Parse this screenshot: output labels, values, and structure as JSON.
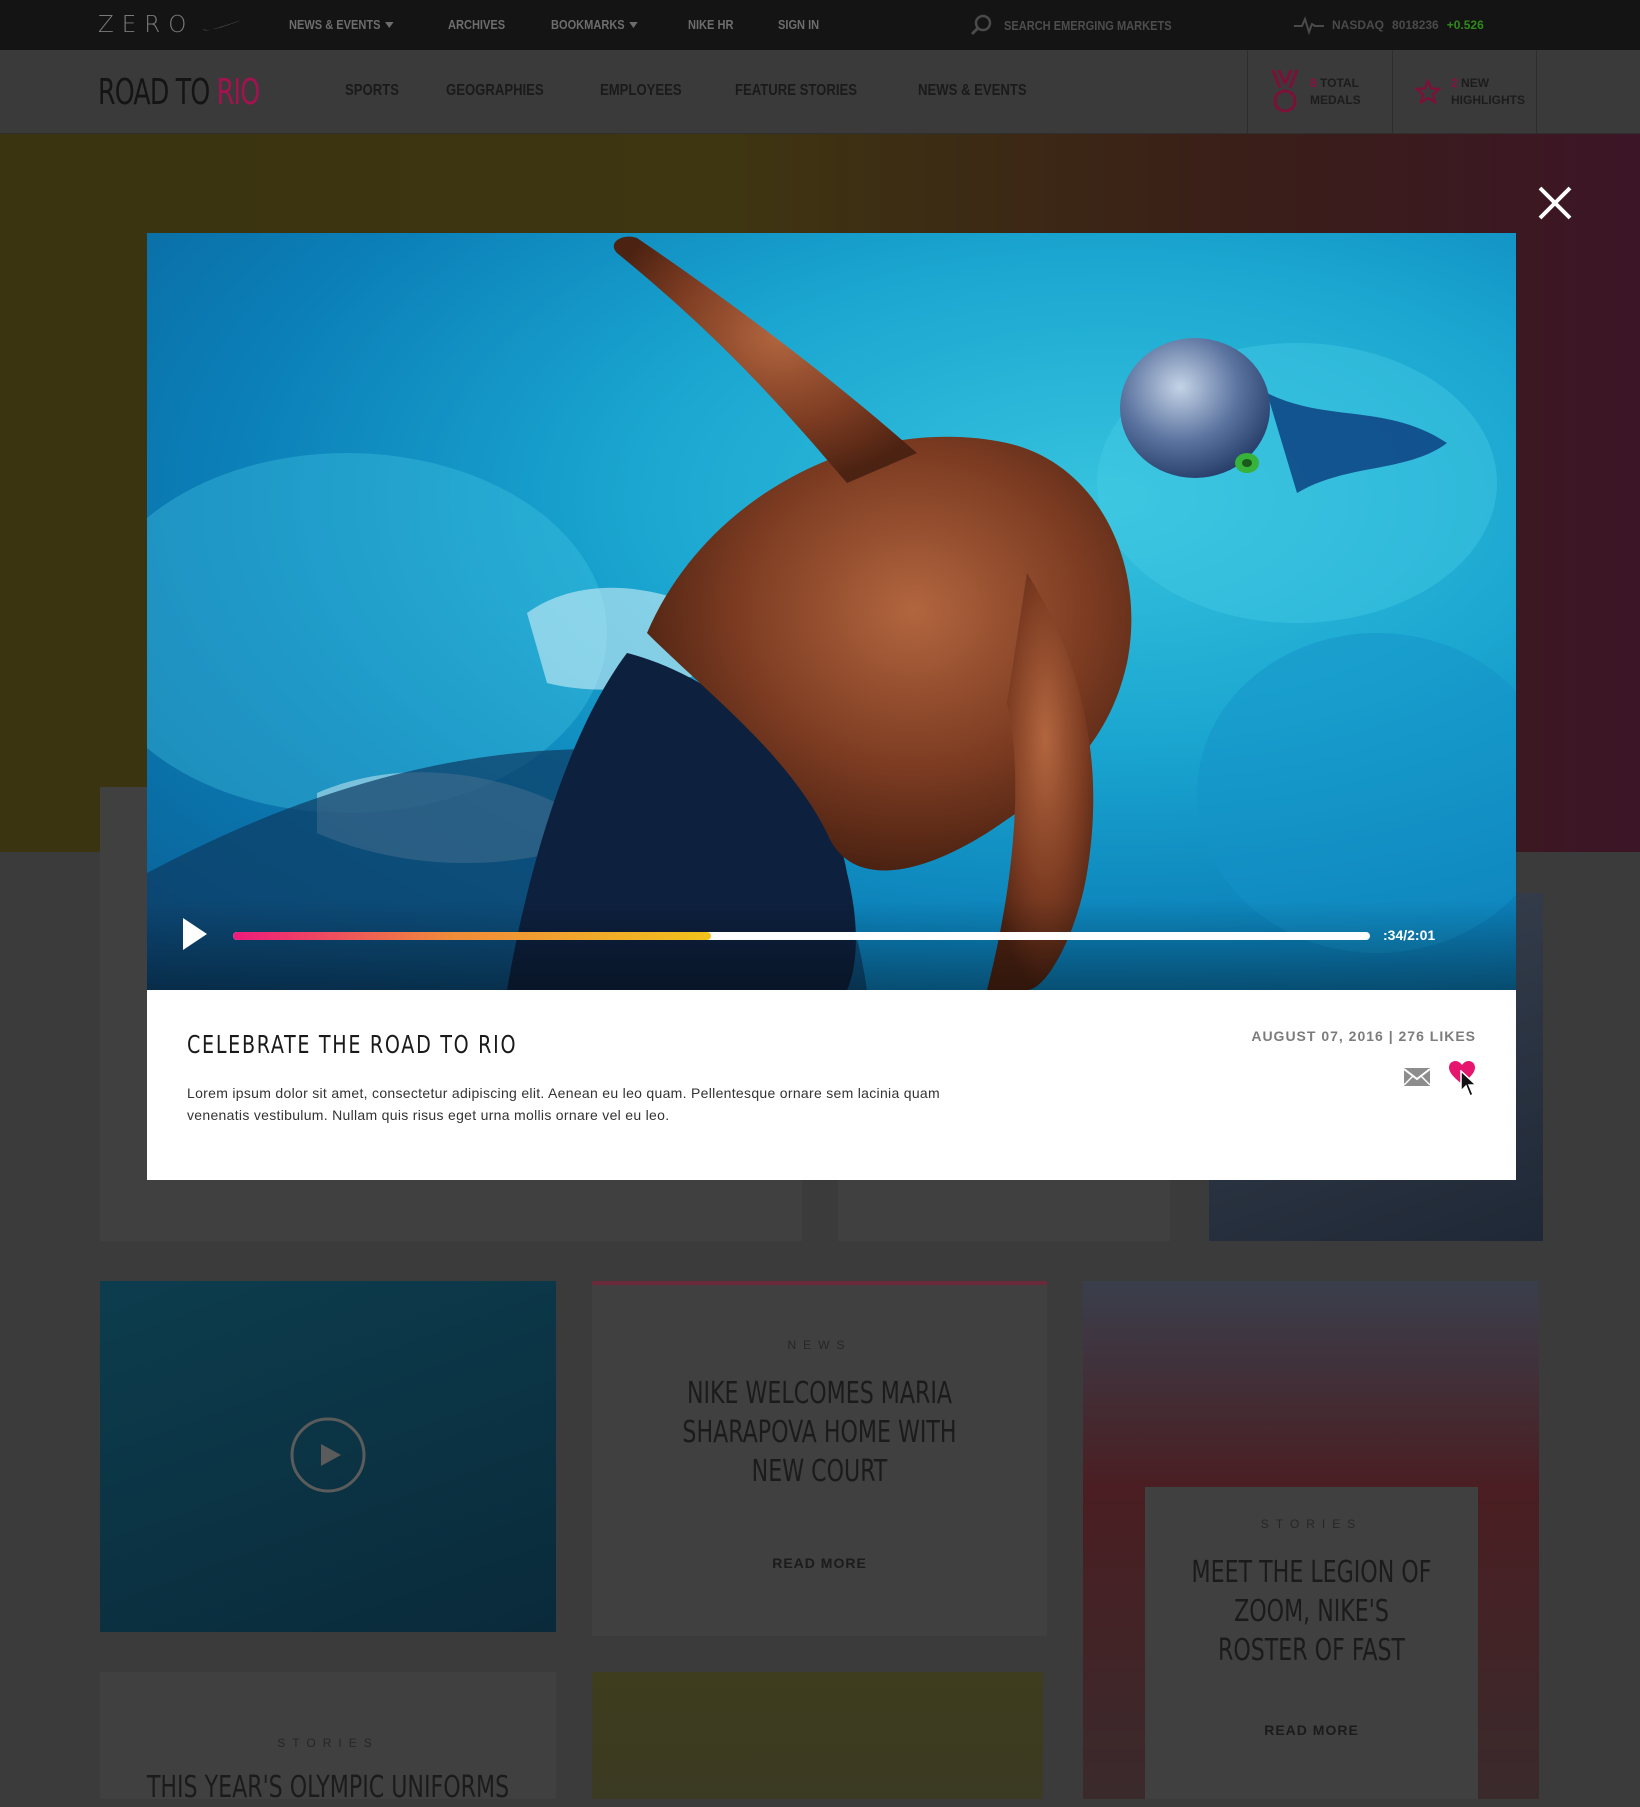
{
  "topbar": {
    "logo": "ZERO",
    "nav": [
      {
        "label": "NEWS & EVENTS",
        "dropdown": true
      },
      {
        "label": "ARCHIVES",
        "dropdown": false
      },
      {
        "label": "BOOKMARKS",
        "dropdown": true
      },
      {
        "label": "NIKE HR",
        "dropdown": false
      },
      {
        "label": "SIGN IN",
        "dropdown": false
      }
    ],
    "search_placeholder": "SEARCH EMERGING MARKETS",
    "ticker": {
      "label": "NASDAQ",
      "value": "8018236",
      "change": "+0.526",
      "change_color": "#2f8a1c"
    }
  },
  "header": {
    "brand": "ROAD TO",
    "brand_accent": "RIO",
    "nav": [
      "SPORTS",
      "GEOGRAPHIES",
      "EMPLOYEES",
      "FEATURE STORIES",
      "NEWS & EVENTS"
    ],
    "stats": [
      {
        "count": "8",
        "line1": "TOTAL",
        "line2": "MEDALS",
        "icon": "medal-icon"
      },
      {
        "count": "2",
        "line1": "NEW",
        "line2": "HIGHLIGHTS",
        "icon": "star-icon"
      }
    ]
  },
  "modal": {
    "title": "CELEBRATE THE ROAD TO RIO",
    "description": "Lorem ipsum dolor sit amet, consectetur adipiscing elit. Aenean eu leo quam. Pellentesque ornare sem lacinia quam venenatis vestibulum. Nullam quis risus eget urna mollis ornare vel eu leo.",
    "meta": "AUGUST 07, 2016 | 276 LIKES",
    "video": {
      "time": ":34/2:01",
      "progress": 0.42,
      "subject": "swimmer-freestyle-photo"
    }
  },
  "background_cards": [
    {
      "kicker": "NEWS",
      "title": "NIKE WELCOMES MARIA SHARAPOVA HOME WITH NEW COURT",
      "cta": "READ MORE"
    },
    {
      "kicker": "STORIES",
      "title": "MEET THE LEGION OF ZOOM, NIKE'S ROSTER OF FAST",
      "cta": "READ MORE"
    },
    {
      "kicker": "STORIES",
      "title": "THIS YEAR'S OLYMPIC UNIFORMS"
    }
  ],
  "colors": {
    "accent": "#e6166f",
    "brand_dim": "#a4124f",
    "overlay": "#3c3b3b"
  }
}
